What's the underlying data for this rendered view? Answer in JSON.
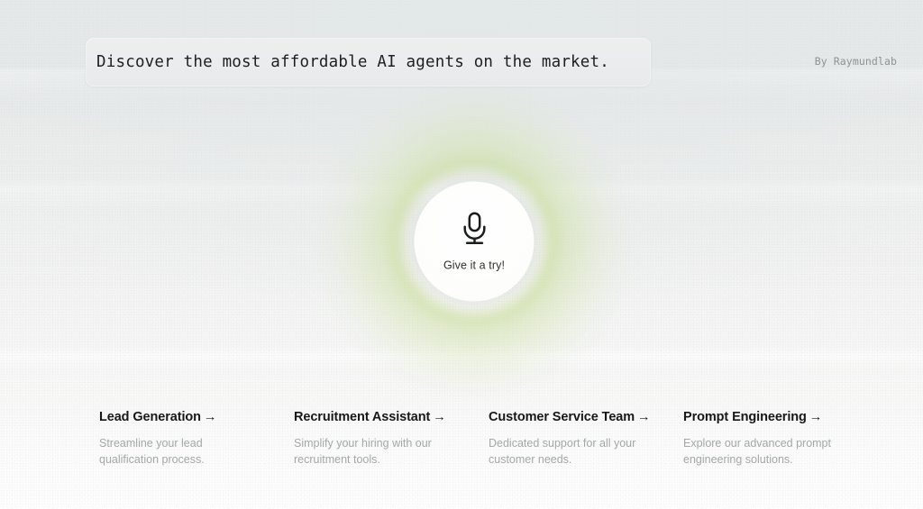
{
  "hero": {
    "headline": "Discover the most affordable AI agents on the market.",
    "byline": "By Raymundlab"
  },
  "mic": {
    "label": "Give it a try!",
    "icon": "microphone-icon",
    "glow_color": "#cde1a0"
  },
  "cards": [
    {
      "title": "Lead Generation",
      "arrow": "→",
      "description": "Streamline your lead qualification process."
    },
    {
      "title": "Recruitment Assistant",
      "arrow": "→",
      "description": "Simplify your hiring with our recruitment tools."
    },
    {
      "title": "Customer Service Team",
      "arrow": "→",
      "description": "Dedicated support for all your customer needs."
    },
    {
      "title": "Prompt Engineering",
      "arrow": "→",
      "description": "Explore our advanced prompt engineering solutions."
    }
  ],
  "theme": {
    "bg_top": "#e6e9e9",
    "bg_bottom": "#fdfdfd",
    "text_primary": "#16181a",
    "text_muted": "#a3a8a9",
    "byline_color": "#8d9293"
  }
}
